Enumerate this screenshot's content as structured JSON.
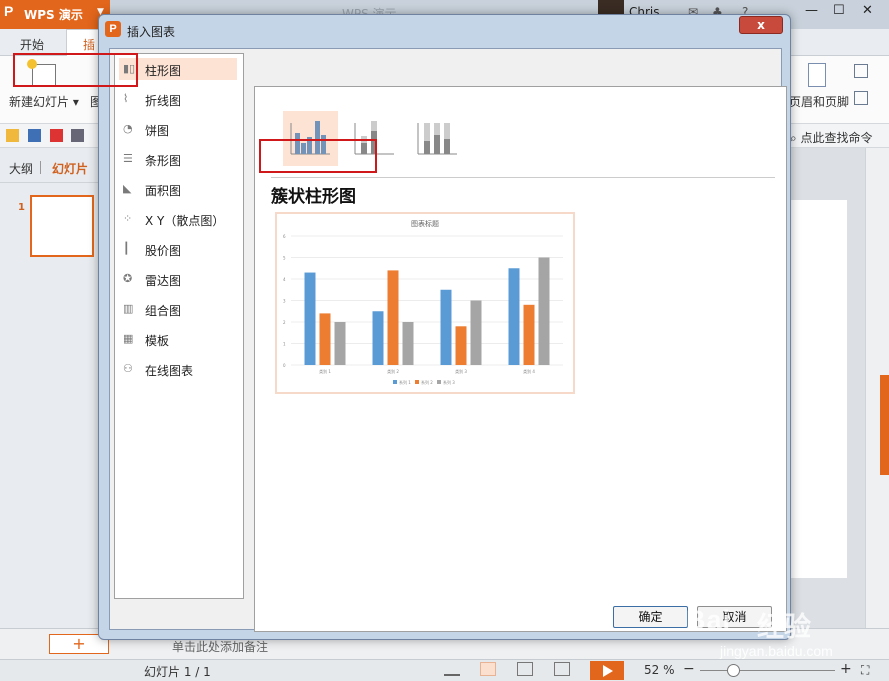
{
  "app": {
    "logo_letter": "P",
    "logo_text": "WPS 演示",
    "window_title": "WPS 演示",
    "user_name": "Chris",
    "tabs": [
      "开始",
      "插入"
    ],
    "ribbon": {
      "new_slide": "新建幻灯片",
      "new_slide_suffix": "图",
      "header_footer": "页眉和页脚"
    },
    "find_command": "点此查找命令",
    "left_panel": {
      "outline": "大纲",
      "slides": "幻灯片",
      "slide_number": "1"
    },
    "notes_placeholder": "单击此处添加备注",
    "add_slide": "+",
    "status": {
      "slide_info": "幻灯片 1 / 1",
      "zoom": "52 %"
    }
  },
  "dialog": {
    "title_icon": "P",
    "title": "插入图表",
    "close_label": "x",
    "chart_types": [
      {
        "label": "柱形图",
        "icon": "column-chart-icon"
      },
      {
        "label": "折线图",
        "icon": "line-chart-icon"
      },
      {
        "label": "饼图",
        "icon": "pie-chart-icon"
      },
      {
        "label": "条形图",
        "icon": "bar-chart-icon"
      },
      {
        "label": "面积图",
        "icon": "area-chart-icon"
      },
      {
        "label": "X Y（散点图）",
        "icon": "scatter-chart-icon"
      },
      {
        "label": "股价图",
        "icon": "stock-chart-icon"
      },
      {
        "label": "雷达图",
        "icon": "radar-chart-icon"
      },
      {
        "label": "组合图",
        "icon": "combo-chart-icon"
      },
      {
        "label": "模板",
        "icon": "template-icon"
      },
      {
        "label": "在线图表",
        "icon": "online-chart-icon"
      }
    ],
    "selected_type": "柱形图",
    "subtypes": [
      "clustered-column",
      "stacked-column",
      "percent-stacked-column"
    ],
    "selected_subtype_title": "簇状柱形图",
    "ok_button": "确定",
    "cancel_button": "取消"
  },
  "chart_data": {
    "type": "bar",
    "title": "图表标题",
    "categories": [
      "类别 1",
      "类别 2",
      "类别 3",
      "类别 4"
    ],
    "series": [
      {
        "name": "系列 1",
        "values": [
          4.3,
          2.5,
          3.5,
          4.5
        ],
        "color": "#5b9bd5"
      },
      {
        "name": "系列 2",
        "values": [
          2.4,
          4.4,
          1.8,
          2.8
        ],
        "color": "#ed7d31"
      },
      {
        "name": "系列 3",
        "values": [
          2.0,
          2.0,
          3.0,
          5.0
        ],
        "color": "#a5a5a5"
      }
    ],
    "ylim": [
      0,
      6
    ],
    "yticks": [
      "0",
      "1",
      "2",
      "3",
      "4",
      "5",
      "6"
    ],
    "grid": true,
    "legend": "bottom"
  },
  "watermark": {
    "brand": "Bai",
    "brand_cn": "经验",
    "url": "jingyan.baidu.com"
  },
  "colors": {
    "accent": "#e2661c",
    "highlight": "#d0181b",
    "selection_bg": "#fde3d4"
  }
}
